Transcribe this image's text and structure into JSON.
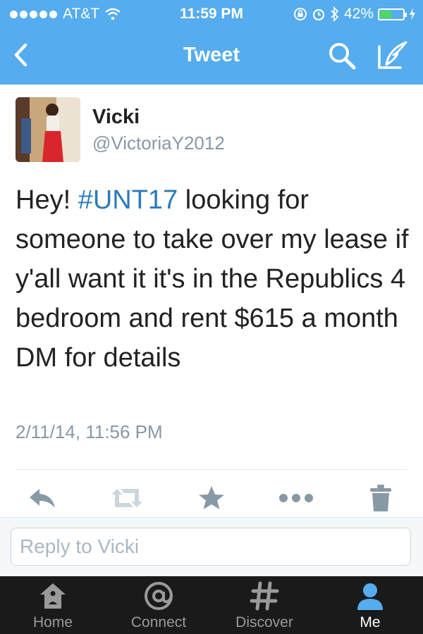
{
  "status_bar": {
    "carrier": "AT&T",
    "time": "11:59 PM",
    "battery": "42%"
  },
  "nav": {
    "title": "Tweet",
    "back_icon": "back-chevron-icon",
    "search_icon": "search-icon",
    "compose_icon": "compose-icon"
  },
  "tweet": {
    "name": "Vicki",
    "handle": "@VictoriaY2012",
    "text_before": "Hey! ",
    "hashtag": "#UNT17",
    "text_after": " looking for someone to take over my lease if y'all want it it's in the Republics 4 bedroom and rent $615 a month DM for details",
    "timestamp": "2/11/14, 11:56 PM"
  },
  "actions": [
    "reply-icon",
    "retweet-icon",
    "favorite-icon",
    "more-icon",
    "delete-icon"
  ],
  "reply": {
    "placeholder": "Reply to Vicki"
  },
  "tabs": [
    {
      "label": "Home",
      "icon": "home-icon"
    },
    {
      "label": "Connect",
      "icon": "at-icon"
    },
    {
      "label": "Discover",
      "icon": "hashtag-icon"
    },
    {
      "label": "Me",
      "icon": "person-icon"
    }
  ],
  "colors": {
    "header": "#55acee",
    "link": "#2b7bb9",
    "tab_bar": "#1a1a1a",
    "active_tab": "#55acee"
  }
}
